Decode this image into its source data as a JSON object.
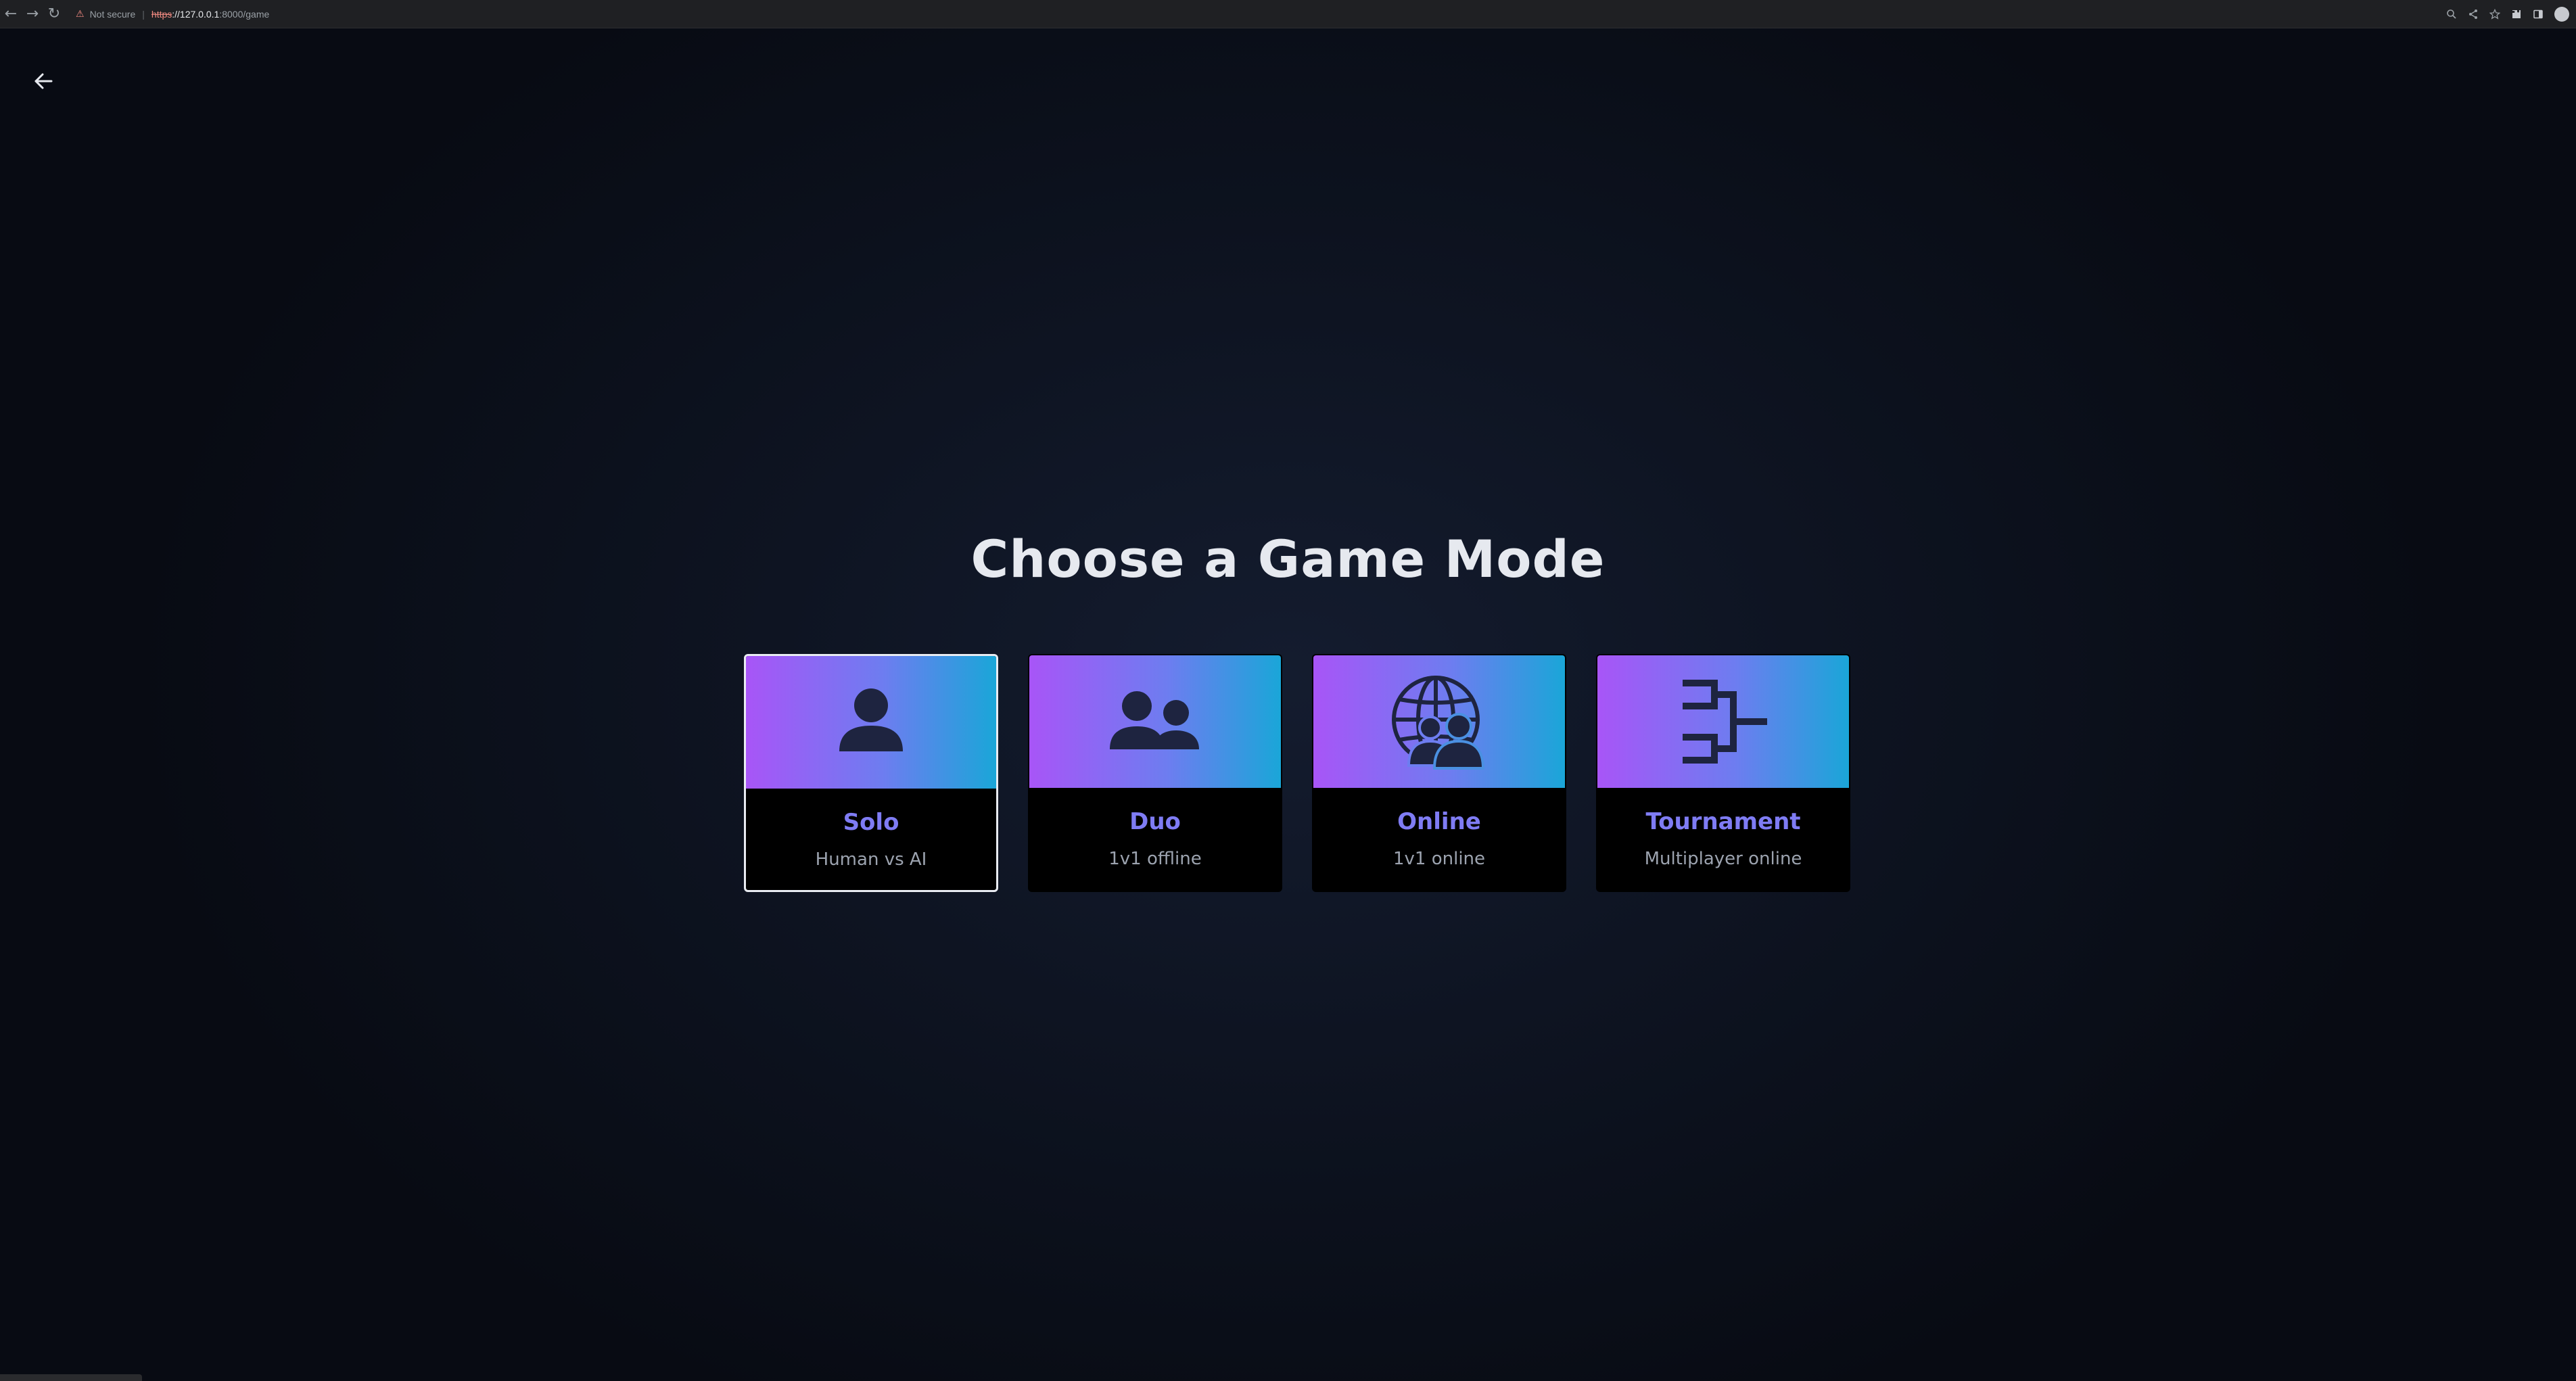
{
  "browser": {
    "nav": {
      "back_icon": "←",
      "forward_icon": "→",
      "reload_icon": "↻"
    },
    "warning_icon": "⚠",
    "not_secure": "Not secure",
    "separator": "|",
    "url_scheme": "https",
    "url_host": "://127.0.0.1",
    "url_path": ":8000/game",
    "icons": [
      "zoom-icon",
      "share-icon",
      "star-icon",
      "extensions-icon",
      "sidebar-icon",
      "profile-icon"
    ]
  },
  "page": {
    "title": "Choose a Game Mode",
    "modes": [
      {
        "name": "Solo",
        "desc": "Human vs AI",
        "icon": "person-icon",
        "selected": true
      },
      {
        "name": "Duo",
        "desc": "1v1 offline",
        "icon": "two-people-icon",
        "selected": false
      },
      {
        "name": "Online",
        "desc": "1v1 online",
        "icon": "globe-people-icon",
        "selected": false
      },
      {
        "name": "Tournament",
        "desc": "Multiplayer online",
        "icon": "bracket-icon",
        "selected": false
      }
    ]
  },
  "colors": {
    "gradient_start": "#a855f7",
    "gradient_end": "#1aa6d8",
    "card_title": "#7f7cf4",
    "card_desc": "#9ca3af",
    "icon_fill": "#1e2440",
    "page_title": "#e6e9ef"
  }
}
